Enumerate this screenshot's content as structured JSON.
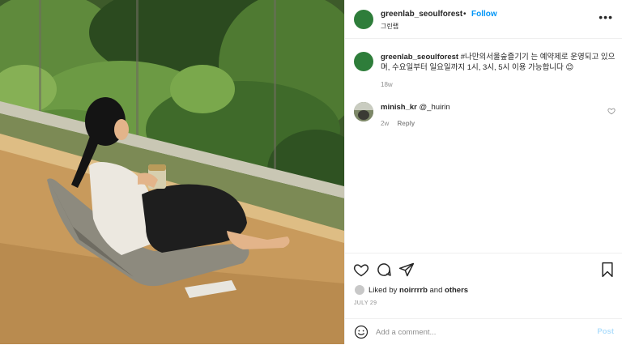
{
  "header": {
    "username": "greenlab_seoulforest",
    "separator": "•",
    "follow_label": "Follow",
    "location": "그린랩",
    "more_label": "•••"
  },
  "caption": {
    "username": "greenlab_seoulforest",
    "text": "#나만의서울숲즐기기 는 예약제로 운영되고 있으며, 수요일부터 일요일까지 1시, 3시, 5시 이용 가능합니다 😊",
    "age": "18w"
  },
  "comment": {
    "username": "minish_kr",
    "text": "@_huirin",
    "age": "2w",
    "reply_label": "Reply"
  },
  "actions": {
    "icons": [
      "heart-icon",
      "comment-icon",
      "share-icon",
      "bookmark-icon"
    ]
  },
  "likes": {
    "prefix": "Liked by",
    "user": "noirrrrb",
    "connector": "and",
    "others": "others"
  },
  "date": "JULY 29",
  "add_comment": {
    "placeholder": "Add a comment...",
    "post_label": "Post"
  },
  "colors": {
    "follow": "#0095f6",
    "avatar": "#2e7d3a",
    "muted": "#8e8e8e",
    "post_disabled": "#b2dffc"
  }
}
